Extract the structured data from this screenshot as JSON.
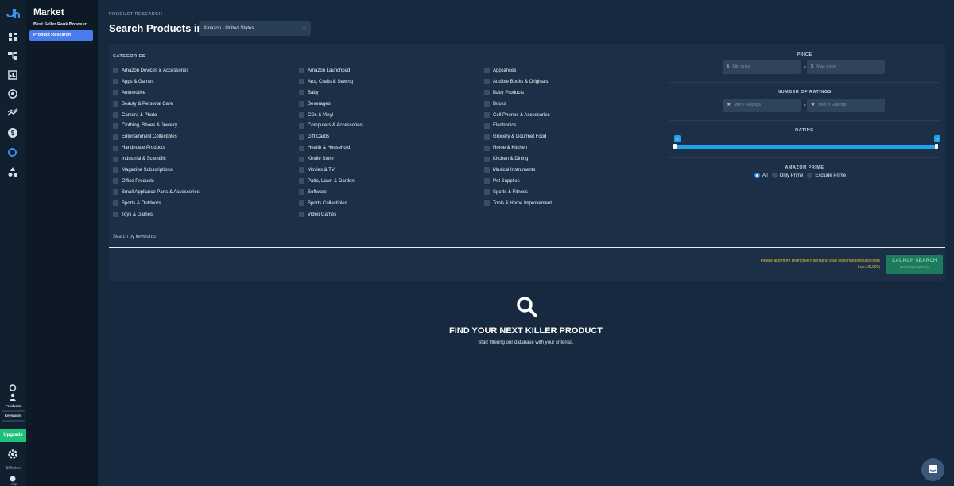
{
  "rail": {
    "upgrade_label": "Upgrade",
    "products_label": "Products",
    "keywords_label": "Keywords",
    "affiliates_label": "Affiliates",
    "help_label": "Help"
  },
  "sidebar": {
    "title": "Market",
    "items": [
      "Best Seller Rank Browser",
      "Product Research"
    ]
  },
  "header": {
    "breadcrumb": "PRODUCT RESEARCH",
    "title": "Search Products in",
    "market_selected": "Amazon - United States"
  },
  "categories": {
    "title": "CATEGORIES",
    "columns": [
      [
        "Amazon Devices & Accessories",
        "Apps & Games",
        "Automotive",
        "Beauty & Personal Care",
        "Camera & Photo",
        "Clothing, Shoes & Jewelry",
        "Entertainment Collectibles",
        "Handmade Products",
        "Industrial & Scientific",
        "Magazine Subscriptions",
        "Office Products",
        "Small Appliance Parts & Accessories",
        "Sports & Outdoors",
        "Toys & Games"
      ],
      [
        "Amazon Launchpad",
        "Arts, Crafts & Sewing",
        "Baby",
        "Beverages",
        "CDs & Vinyl",
        "Computers & Accessories",
        "Gift Cards",
        "Health & Household",
        "Kindle Store",
        "Movies & TV",
        "Patio, Lawn & Garden",
        "Software",
        "Sports Collectibles",
        "Video Games"
      ],
      [
        "Appliances",
        "Audible Books & Originals",
        "Baby Products",
        "Books",
        "Cell Phones & Accessories",
        "Electronics",
        "Grocery & Gourmet Food",
        "Home & Kitchen",
        "Kitchen & Dining",
        "Musical Instruments",
        "Pet Supplies",
        "Sports & Fitness",
        "Tools & Home Improvement"
      ]
    ]
  },
  "filters": {
    "price": {
      "title": "PRICE",
      "prefix": "$",
      "min_placeholder": "Min price",
      "max_placeholder": "Max price"
    },
    "ratings": {
      "title": "NUMBER OF RATINGS",
      "prefix": "★",
      "min_placeholder": "Min # Ratings",
      "max_placeholder": "Max # Ratings"
    },
    "rating": {
      "title": "RATING",
      "min": "0",
      "max": "5",
      "low_value": 0,
      "high_value": 5
    },
    "prime": {
      "title": "AMAZON PRIME",
      "options": [
        "All",
        "Only Prime",
        "Exclude Prime"
      ],
      "selected": "All"
    },
    "range_separator": "-"
  },
  "search": {
    "keyword_placeholder": "Search by keywords",
    "warning": "Please add more restrictive criterias to start exploring products (less than 50,000)",
    "launch_label": "LAUNCH SEARCH",
    "launch_count": "620,676 product(s)"
  },
  "empty_state": {
    "title": "FIND YOUR NEXT KILLER PRODUCT",
    "subtitle": "Start filtering our database with your criterias."
  },
  "colors": {
    "background": "#17293f",
    "accent": "#4a7bef",
    "slider": "#1fa2f0",
    "upgrade": "#1ec07a",
    "warning": "#e8c23a",
    "launch": "#1e7a5d"
  }
}
